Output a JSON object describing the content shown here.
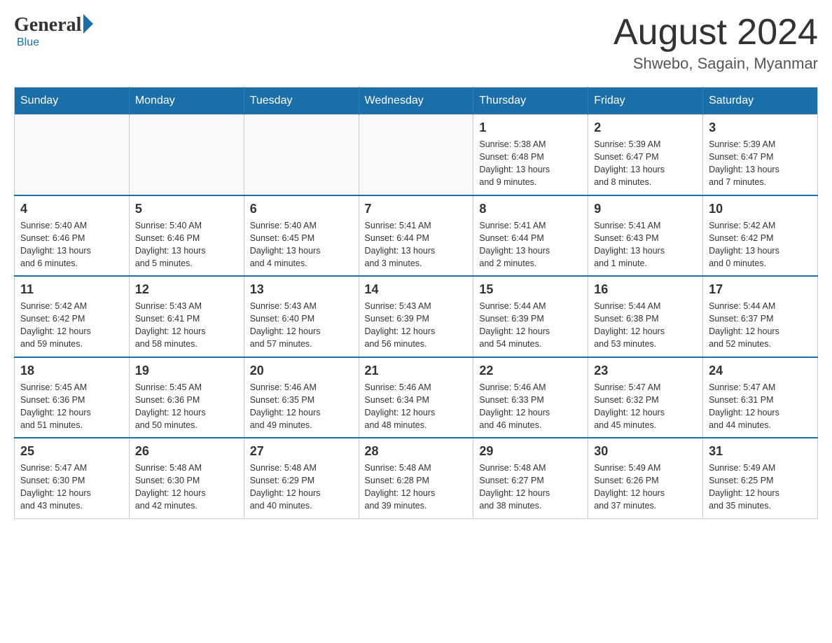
{
  "header": {
    "logo": {
      "general": "General",
      "blue": "Blue"
    },
    "title": "August 2024",
    "location": "Shwebo, Sagain, Myanmar"
  },
  "days_of_week": [
    "Sunday",
    "Monday",
    "Tuesday",
    "Wednesday",
    "Thursday",
    "Friday",
    "Saturday"
  ],
  "weeks": [
    {
      "days": [
        {
          "number": "",
          "info": ""
        },
        {
          "number": "",
          "info": ""
        },
        {
          "number": "",
          "info": ""
        },
        {
          "number": "",
          "info": ""
        },
        {
          "number": "1",
          "info": "Sunrise: 5:38 AM\nSunset: 6:48 PM\nDaylight: 13 hours\nand 9 minutes."
        },
        {
          "number": "2",
          "info": "Sunrise: 5:39 AM\nSunset: 6:47 PM\nDaylight: 13 hours\nand 8 minutes."
        },
        {
          "number": "3",
          "info": "Sunrise: 5:39 AM\nSunset: 6:47 PM\nDaylight: 13 hours\nand 7 minutes."
        }
      ]
    },
    {
      "days": [
        {
          "number": "4",
          "info": "Sunrise: 5:40 AM\nSunset: 6:46 PM\nDaylight: 13 hours\nand 6 minutes."
        },
        {
          "number": "5",
          "info": "Sunrise: 5:40 AM\nSunset: 6:46 PM\nDaylight: 13 hours\nand 5 minutes."
        },
        {
          "number": "6",
          "info": "Sunrise: 5:40 AM\nSunset: 6:45 PM\nDaylight: 13 hours\nand 4 minutes."
        },
        {
          "number": "7",
          "info": "Sunrise: 5:41 AM\nSunset: 6:44 PM\nDaylight: 13 hours\nand 3 minutes."
        },
        {
          "number": "8",
          "info": "Sunrise: 5:41 AM\nSunset: 6:44 PM\nDaylight: 13 hours\nand 2 minutes."
        },
        {
          "number": "9",
          "info": "Sunrise: 5:41 AM\nSunset: 6:43 PM\nDaylight: 13 hours\nand 1 minute."
        },
        {
          "number": "10",
          "info": "Sunrise: 5:42 AM\nSunset: 6:42 PM\nDaylight: 13 hours\nand 0 minutes."
        }
      ]
    },
    {
      "days": [
        {
          "number": "11",
          "info": "Sunrise: 5:42 AM\nSunset: 6:42 PM\nDaylight: 12 hours\nand 59 minutes."
        },
        {
          "number": "12",
          "info": "Sunrise: 5:43 AM\nSunset: 6:41 PM\nDaylight: 12 hours\nand 58 minutes."
        },
        {
          "number": "13",
          "info": "Sunrise: 5:43 AM\nSunset: 6:40 PM\nDaylight: 12 hours\nand 57 minutes."
        },
        {
          "number": "14",
          "info": "Sunrise: 5:43 AM\nSunset: 6:39 PM\nDaylight: 12 hours\nand 56 minutes."
        },
        {
          "number": "15",
          "info": "Sunrise: 5:44 AM\nSunset: 6:39 PM\nDaylight: 12 hours\nand 54 minutes."
        },
        {
          "number": "16",
          "info": "Sunrise: 5:44 AM\nSunset: 6:38 PM\nDaylight: 12 hours\nand 53 minutes."
        },
        {
          "number": "17",
          "info": "Sunrise: 5:44 AM\nSunset: 6:37 PM\nDaylight: 12 hours\nand 52 minutes."
        }
      ]
    },
    {
      "days": [
        {
          "number": "18",
          "info": "Sunrise: 5:45 AM\nSunset: 6:36 PM\nDaylight: 12 hours\nand 51 minutes."
        },
        {
          "number": "19",
          "info": "Sunrise: 5:45 AM\nSunset: 6:36 PM\nDaylight: 12 hours\nand 50 minutes."
        },
        {
          "number": "20",
          "info": "Sunrise: 5:46 AM\nSunset: 6:35 PM\nDaylight: 12 hours\nand 49 minutes."
        },
        {
          "number": "21",
          "info": "Sunrise: 5:46 AM\nSunset: 6:34 PM\nDaylight: 12 hours\nand 48 minutes."
        },
        {
          "number": "22",
          "info": "Sunrise: 5:46 AM\nSunset: 6:33 PM\nDaylight: 12 hours\nand 46 minutes."
        },
        {
          "number": "23",
          "info": "Sunrise: 5:47 AM\nSunset: 6:32 PM\nDaylight: 12 hours\nand 45 minutes."
        },
        {
          "number": "24",
          "info": "Sunrise: 5:47 AM\nSunset: 6:31 PM\nDaylight: 12 hours\nand 44 minutes."
        }
      ]
    },
    {
      "days": [
        {
          "number": "25",
          "info": "Sunrise: 5:47 AM\nSunset: 6:30 PM\nDaylight: 12 hours\nand 43 minutes."
        },
        {
          "number": "26",
          "info": "Sunrise: 5:48 AM\nSunset: 6:30 PM\nDaylight: 12 hours\nand 42 minutes."
        },
        {
          "number": "27",
          "info": "Sunrise: 5:48 AM\nSunset: 6:29 PM\nDaylight: 12 hours\nand 40 minutes."
        },
        {
          "number": "28",
          "info": "Sunrise: 5:48 AM\nSunset: 6:28 PM\nDaylight: 12 hours\nand 39 minutes."
        },
        {
          "number": "29",
          "info": "Sunrise: 5:48 AM\nSunset: 6:27 PM\nDaylight: 12 hours\nand 38 minutes."
        },
        {
          "number": "30",
          "info": "Sunrise: 5:49 AM\nSunset: 6:26 PM\nDaylight: 12 hours\nand 37 minutes."
        },
        {
          "number": "31",
          "info": "Sunrise: 5:49 AM\nSunset: 6:25 PM\nDaylight: 12 hours\nand 35 minutes."
        }
      ]
    }
  ]
}
